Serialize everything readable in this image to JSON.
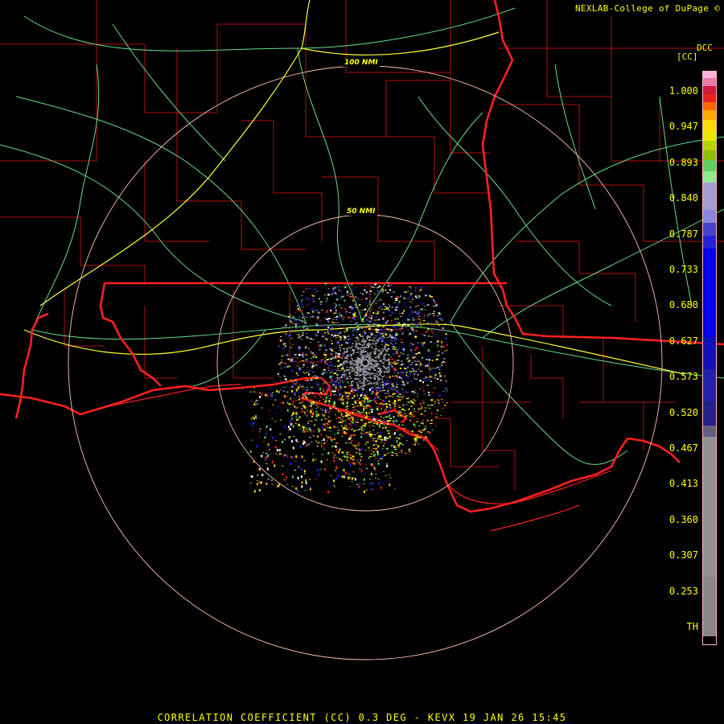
{
  "header": {
    "credit": "NEXLAB-College of DuPage ©",
    "site_code": "DCC",
    "unit": "[CC]"
  },
  "rings": {
    "outer_label": "100 NMI",
    "inner_label": "50 NMI"
  },
  "legend": {
    "ticks": [
      "1.000",
      "0.947",
      "0.893",
      "0.840",
      "0.787",
      "0.733",
      "0.680",
      "0.627",
      "0.573",
      "0.520",
      "0.467",
      "0.413",
      "0.360",
      "0.307",
      "0.253",
      "TH"
    ],
    "colors": [
      "#ffb3d9",
      "#e87aa8",
      "#cc1a3a",
      "#e82020",
      "#ff6600",
      "#ffaa00",
      "#ffdd00",
      "#e8e800",
      "#b4d400",
      "#8cc000",
      "#60d060",
      "#90e890",
      "#a0a0d0",
      "#8888e0",
      "#4444cc",
      "#2222dd",
      "#0000ee",
      "#1111bb",
      "#2222aa",
      "#222288",
      "#606080",
      "#909090",
      "#888888"
    ]
  },
  "map_colors": {
    "state_border": "#ff2020",
    "county_border": "#b01010",
    "highway": "#66dd88",
    "interstate": "#ffff33",
    "range_ring": "#ffc0b0"
  },
  "footer": {
    "title": "CORRELATION COEFFICIENT (CC) 0.3 DEG - KEVX 19 JAN 26 15:45"
  }
}
